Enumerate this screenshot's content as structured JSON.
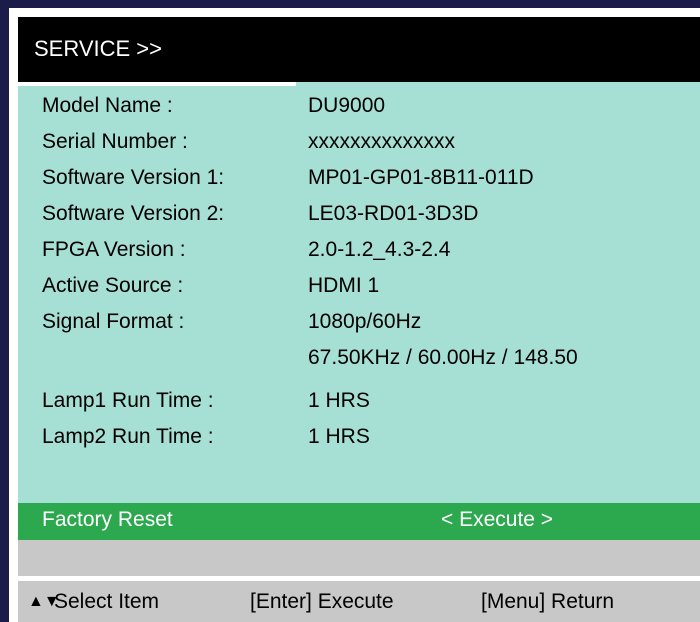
{
  "header": {
    "title": "SERVICE >>"
  },
  "rows": [
    {
      "label": "Model Name :",
      "value": "DU9000"
    },
    {
      "label": "Serial Number :",
      "value": "xxxxxxxxxxxxxx"
    },
    {
      "label": "Software Version 1:",
      "value": "MP01-GP01-8B11-011D"
    },
    {
      "label": "Software Version 2:",
      "value": "LE03-RD01-3D3D"
    },
    {
      "label": "FPGA Version :",
      "value": "2.0-1.2_4.3-2.4"
    },
    {
      "label": "Active Source :",
      "value": "HDMI 1"
    },
    {
      "label": "Signal Format :",
      "value": "1080p/60Hz"
    },
    {
      "label": "",
      "value": "67.50KHz / 60.00Hz / 148.50"
    },
    {
      "label": "Lamp1 Run Time :",
      "value": "1 HRS"
    },
    {
      "label": "Lamp2 Run Time :",
      "value": "1 HRS"
    }
  ],
  "factory_reset": {
    "label": "Factory Reset",
    "action": "< Execute >"
  },
  "footer": {
    "arrows": "▲▼",
    "select": "Select Item",
    "enter": "[Enter] Execute",
    "menu": "[Menu] Return"
  },
  "colors": {
    "panel": "#a6dfd4",
    "header": "#000000",
    "highlight": "#2ca84e",
    "footer": "#c8c8c8"
  }
}
